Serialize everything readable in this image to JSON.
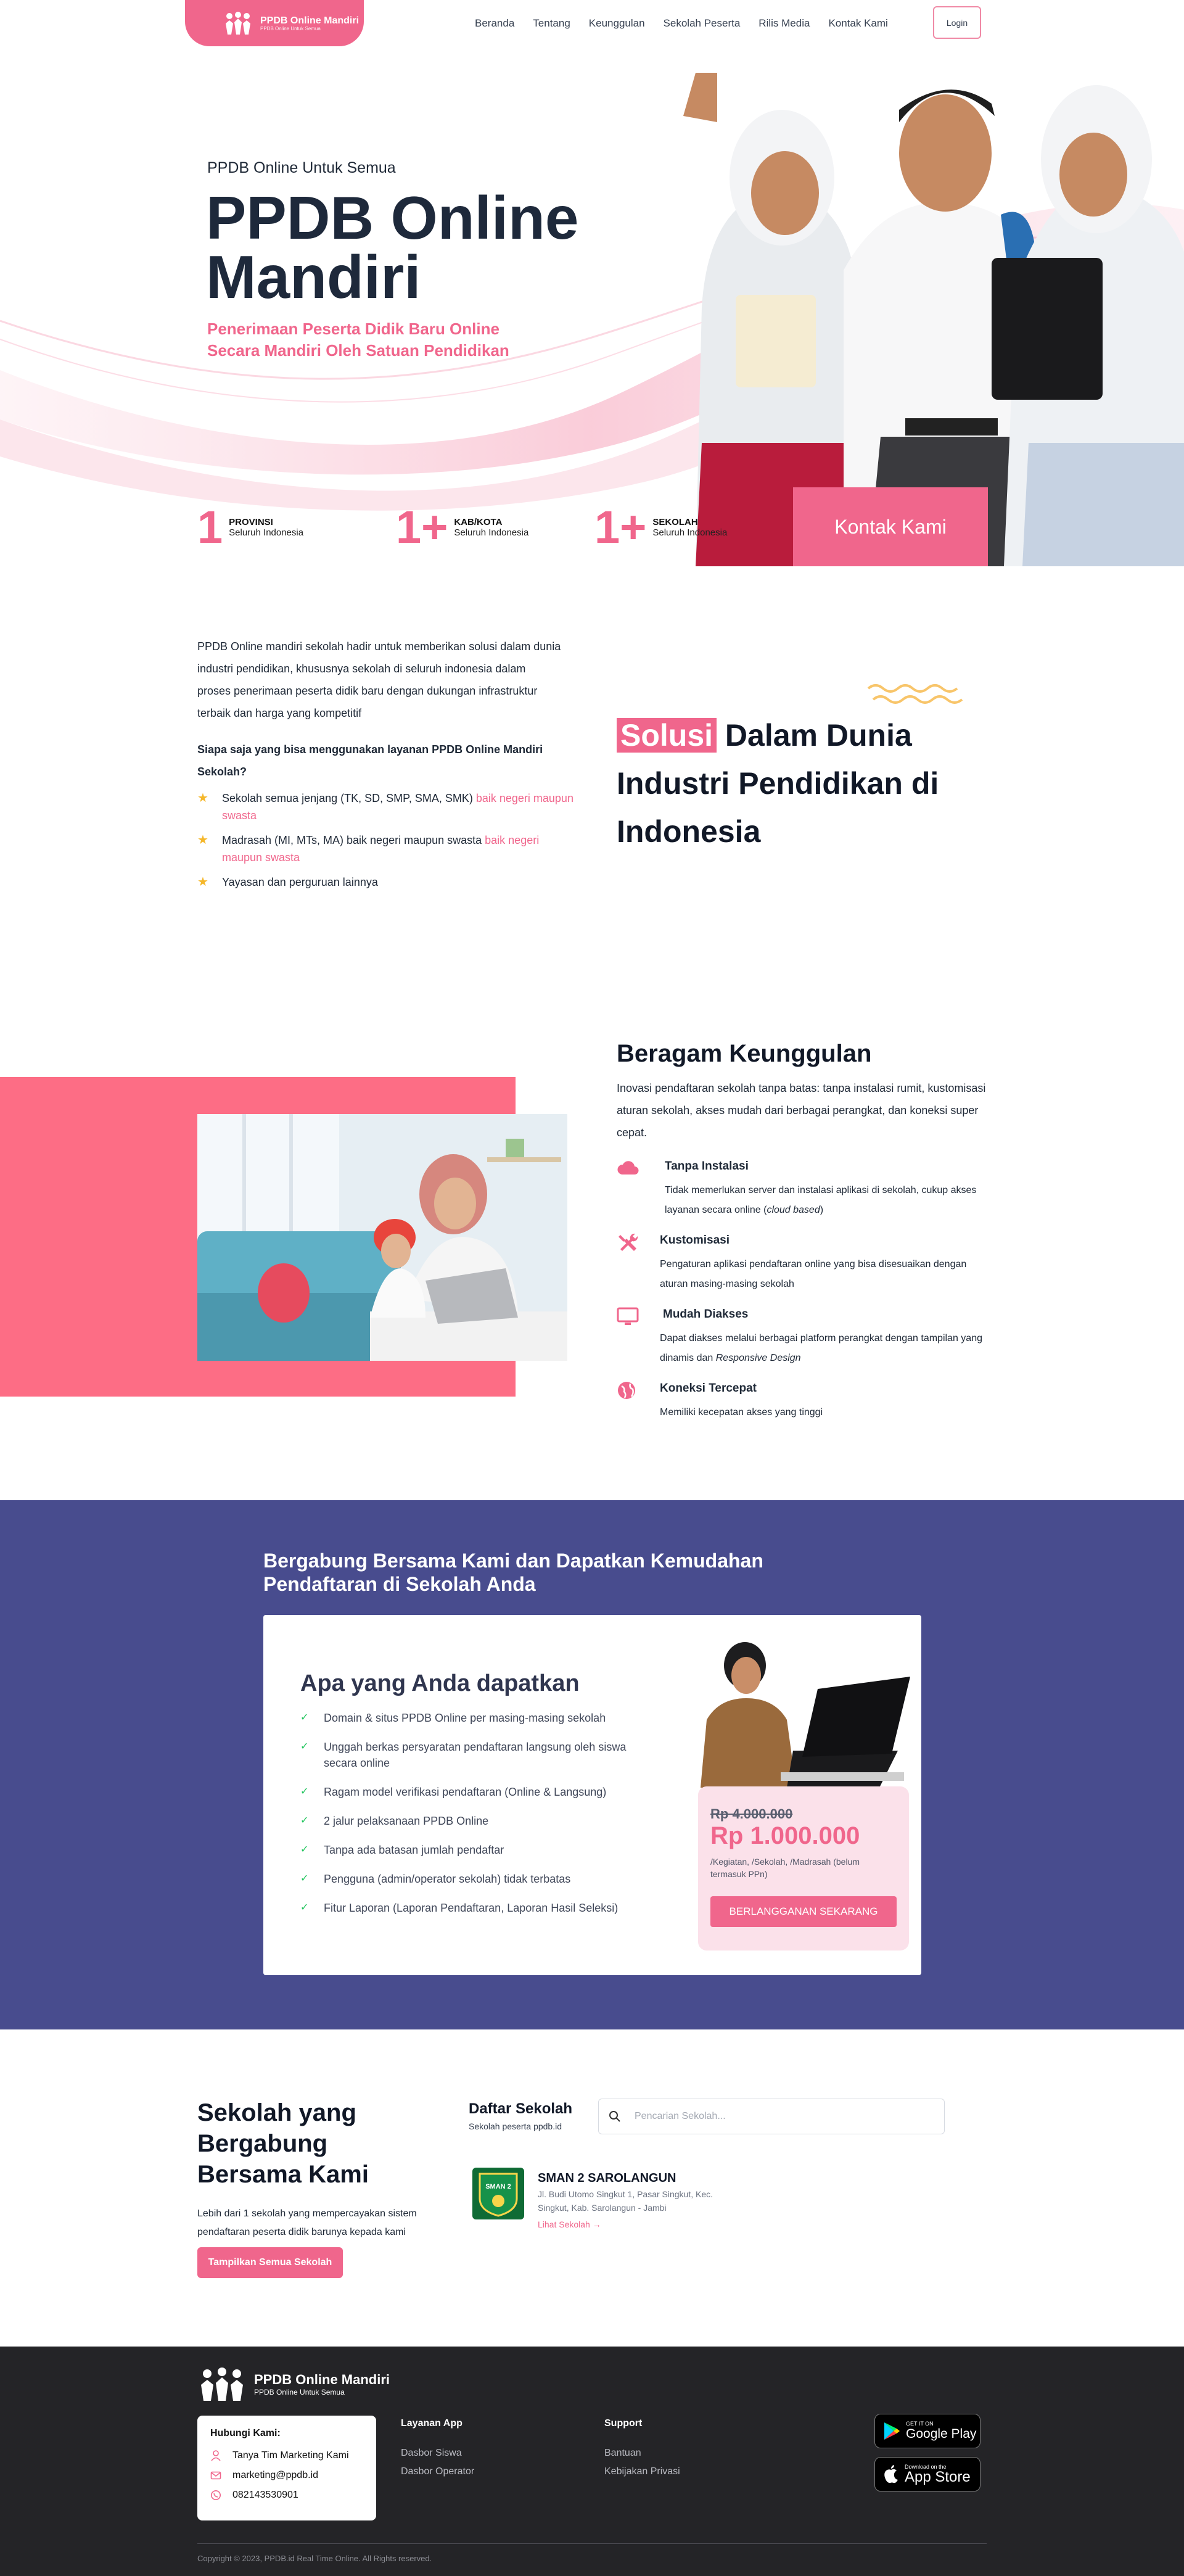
{
  "nav": {
    "brand_name": "PPDB Online Mandiri",
    "brand_tagline": "PPDB Online Untuk Semua",
    "links": [
      "Beranda",
      "Tentang",
      "Keunggulan",
      "Sekolah Peserta",
      "Rilis Media",
      "Kontak Kami"
    ],
    "login_label": "Login"
  },
  "hero": {
    "eyebrow": "PPDB Online Untuk Semua",
    "title_line1": "PPDB Online",
    "title_line2": "Mandiri",
    "subtitle": "Penerimaan Peserta Didik Baru Online Secara Mandiri Oleh Satuan Pendidikan",
    "stats": [
      {
        "num": "1",
        "label": "PROVINSI",
        "sub": "Seluruh Indonesia"
      },
      {
        "num": "1+",
        "label": "KAB/KOTA",
        "sub": "Seluruh Indonesia"
      },
      {
        "num": "1+",
        "label": "SEKOLAH",
        "sub": "Seluruh Indonesia"
      }
    ],
    "contact_label": "Kontak Kami"
  },
  "solusi": {
    "intro": "PPDB Online mandiri sekolah hadir untuk memberikan solusi dalam dunia industri pendidikan, khususnya sekolah di seluruh indonesia dalam proses penerimaan peserta didik baru dengan dukungan infrastruktur terbaik dan harga yang kompetitif",
    "question": "Siapa saja yang bisa menggunakan layanan PPDB Online Mandiri Sekolah?",
    "items": [
      {
        "text": "Sekolah semua jenjang (TK, SD, SMP, SMA, SMK) ",
        "highlight": "baik negeri maupun swasta"
      },
      {
        "text": "Madrasah (MI, MTs, MA) baik negeri maupun swasta ",
        "highlight": "baik negeri maupun swasta"
      },
      {
        "text": "Yayasan dan perguruan lainnya",
        "highlight": ""
      }
    ],
    "title_highlight": "Solusi",
    "title_rest": " Dalam Dunia Industri Pendidikan di Indonesia"
  },
  "keunggulan": {
    "title": "Beragam Keunggulan",
    "desc": "Inovasi pendaftaran sekolah tanpa batas: tanpa instalasi rumit, kustomisasi aturan sekolah, akses mudah dari berbagai perangkat, dan koneksi super cepat.",
    "features": [
      {
        "icon": "cloud-icon",
        "title": "Tanpa Instalasi",
        "desc_pre": "Tidak memerlukan server dan instalasi aplikasi di sekolah, cukup akses layanan secara online (",
        "desc_em": "cloud based",
        "desc_post": ")"
      },
      {
        "icon": "tools-icon",
        "title": "Kustomisasi",
        "desc_pre": "Pengaturan aplikasi pendaftaran online yang bisa disesuaikan dengan aturan masing-masing sekolah",
        "desc_em": "",
        "desc_post": ""
      },
      {
        "icon": "monitor-icon",
        "title": "Mudah Diakses",
        "desc_pre": "Dapat diakses melalui berbagai platform perangkat dengan tampilan yang dinamis dan ",
        "desc_em": "Responsive Design",
        "desc_post": ""
      },
      {
        "icon": "globe-icon",
        "title": "Koneksi Tercepat",
        "desc_pre": "Memiliki kecepatan akses yang tinggi",
        "desc_em": "",
        "desc_post": ""
      }
    ]
  },
  "gabung": {
    "title": "Bergabung Bersama Kami dan Dapatkan Kemudahan Pendaftaran di Sekolah Anda",
    "card_title": "Apa yang Anda dapatkan",
    "benefits": [
      "Domain & situs PPDB Online per masing-masing sekolah",
      "Unggah berkas persyaratan pendaftaran langsung oleh siswa secara online",
      "Ragam model verifikasi pendaftaran (Online & Langsung)",
      "2 jalur pelaksanaan PPDB Online",
      "Tanpa ada batasan jumlah pendaftar",
      "Pengguna (admin/operator sekolah) tidak terbatas",
      "Fitur Laporan (Laporan Pendaftaran, Laporan Hasil Seleksi)"
    ],
    "price_old": "Rp 4.000.000",
    "price_new": "Rp 1.000.000",
    "price_note": "/Kegiatan, /Sekolah, /Madrasah (belum termasuk PPn)",
    "subscribe_label": "BERLANGGANAN SEKARANG"
  },
  "sekolah": {
    "title": "Sekolah yang Bergabung Bersama Kami",
    "desc": "Lebih dari 1 sekolah yang mempercayakan sistem pendaftaran peserta didik barunya kepada kami",
    "show_all_label": "Tampilkan Semua Sekolah",
    "list_title": "Daftar Sekolah",
    "list_sub": "Sekolah peserta ppdb.id",
    "search_placeholder": "Pencarian Sekolah...",
    "school_name": "SMAN 2 SAROLANGUN",
    "school_address": "Jl. Budi Utomo Singkut 1, Pasar Singkut, Kec. Singkut, Kab. Sarolangun - Jambi",
    "school_link": "Lihat Sekolah →",
    "school_logo_text": "SMAN 2"
  },
  "footer": {
    "brand_name": "PPDB Online Mandiri",
    "brand_tagline": "PPDB Online Untuk Semua",
    "contact_head": "Hubungi Kami:",
    "contact_team": "Tanya Tim Marketing Kami",
    "contact_email": "marketing@ppdb.id",
    "contact_phone": "082143530901",
    "col1_title": "Layanan App",
    "col1_links": [
      "Dasbor Siswa",
      "Dasbor Operator"
    ],
    "col2_title": "Support",
    "col2_links": [
      "Bantuan",
      "Kebijakan Privasi"
    ],
    "gplay_small": "GET IT ON",
    "gplay_big": "Google Play",
    "appstore_small": "Download on the",
    "appstore_big": "App Store",
    "copyright": "Copyright © 2023, PPDB.id Real Time Online. All Rights reserved."
  },
  "colors": {
    "accent": "#f0668c",
    "purple": "#484c8e",
    "dark": "#242427",
    "star": "#f5b72a",
    "check": "#22c55e"
  }
}
